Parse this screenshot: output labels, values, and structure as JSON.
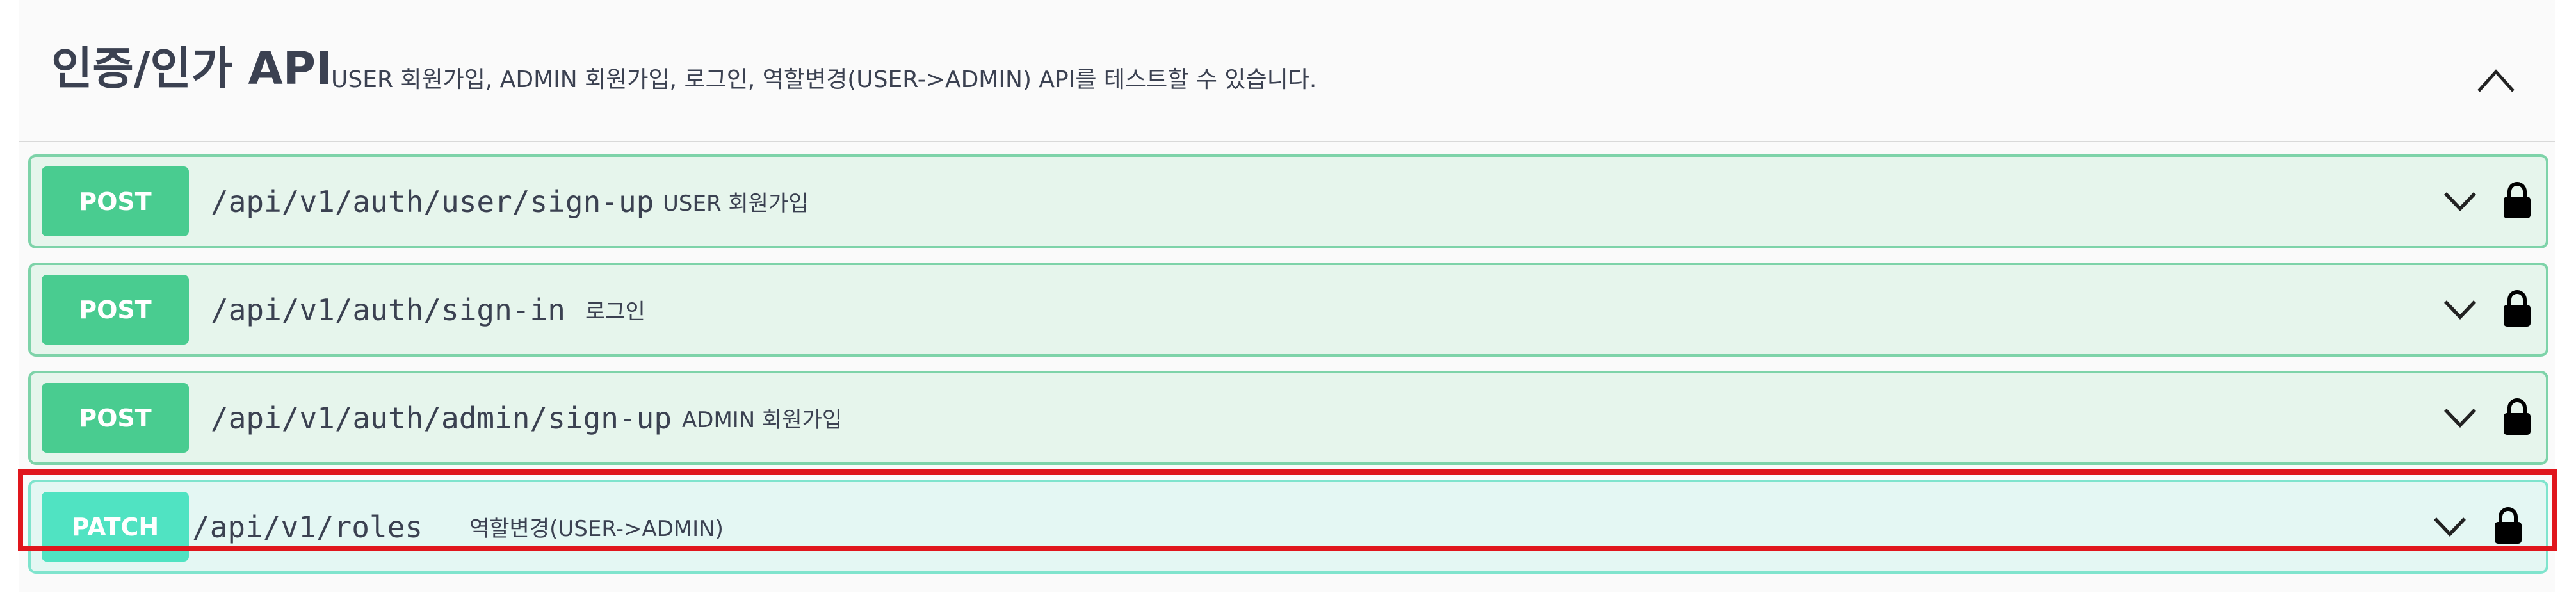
{
  "tag": {
    "name": "인증/인가 API",
    "description": "USER 회원가입, ADMIN 회원가입, 로그인, 역할변경(USER->ADMIN) API를 테스트할 수 있습니다."
  },
  "operations": [
    {
      "method": "POST",
      "path": "/api/v1/auth/user/sign-up",
      "summary": "USER 회원가입"
    },
    {
      "method": "POST",
      "path": "/api/v1/auth/sign-in",
      "summary": "로그인"
    },
    {
      "method": "POST",
      "path": "/api/v1/auth/admin/sign-up",
      "summary": "ADMIN 회원가입"
    },
    {
      "method": "PATCH",
      "path": "/api/v1/roles",
      "summary": "역할변경(USER->ADMIN)"
    }
  ],
  "colors": {
    "post": "#49cc90",
    "patch": "#50e3c2",
    "highlight": "#e0161d"
  },
  "icons": {
    "collapse": "chevron-up-icon",
    "expand": "chevron-down-icon",
    "lock": "lock-icon"
  }
}
